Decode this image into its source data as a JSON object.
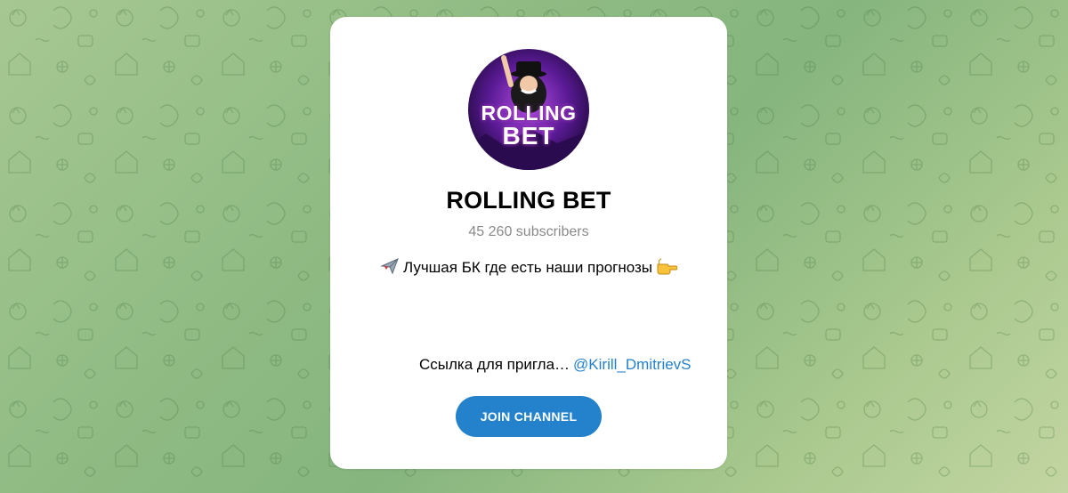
{
  "channel": {
    "title": "ROLLING BET",
    "subscribers": "45 260 subscribers",
    "description_text": "Лучшая БК где есть наши прогнозы",
    "description_icon_left": "airplane-icon",
    "description_icon_right": "pointing-hand-icon",
    "invite_text": "Ссылка для пригла…",
    "invite_link": "@Kirill_DmitrievS",
    "join_label": "JOIN CHANNEL",
    "avatar_text_top": "ROLLING",
    "avatar_text_bottom": "BET"
  },
  "colors": {
    "accent": "#2481cc",
    "background_top": "#a7c792",
    "background_bottom": "#c3d5a2",
    "subscribers_gray": "#8a8a8a",
    "avatar_purple": "#6a1fb0"
  }
}
